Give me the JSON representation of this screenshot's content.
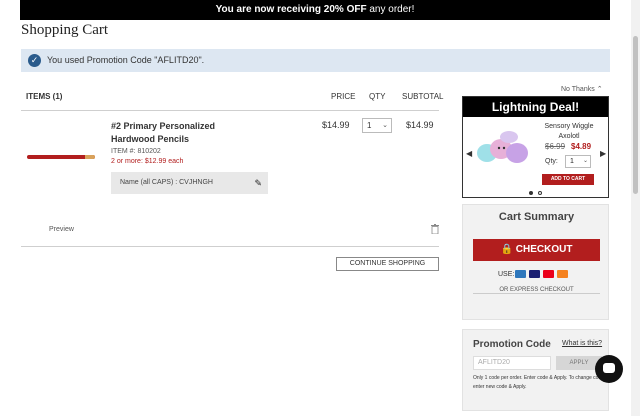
{
  "banner": {
    "bold": "You are now receiving 20% OFF",
    "rest": " any order!"
  },
  "page_title": "Shopping Cart",
  "promo_alert": "You used Promotion Code \"AFLITD20\".",
  "cart": {
    "items_header": "ITEMS (1)",
    "col_price": "PRICE",
    "col_qty": "QTY",
    "col_subtotal": "SUBTOTAL",
    "item": {
      "name": "#2 Primary Personalized Hardwood Pencils",
      "item_number": "ITEM #: 810202",
      "bulk_price": "2 or more: $12.99 each",
      "personalization": "Name (all CAPS) : CVJHNGH",
      "price": "$14.99",
      "qty": "1",
      "subtotal": "$14.99"
    },
    "preview": "Preview",
    "continue_button": "CONTINUE SHOPPING"
  },
  "deal": {
    "no_thanks": "No Thanks",
    "title": "Lightning Deal!",
    "product_name": "Sensory Wiggle Axolotl",
    "old_price": "$6.99",
    "new_price": "$4.89",
    "qty_label": "Qty:",
    "qty": "1",
    "add_button": "ADD TO CART"
  },
  "summary": {
    "title": "Cart Summary",
    "checkout_button": "CHECKOUT",
    "use_label": "USE:",
    "express": "OR EXPRESS CHECKOUT"
  },
  "promo": {
    "title": "Promotion Code",
    "what_is": "What is this?",
    "placeholder": "AFLITD20",
    "apply_button": "APPLY",
    "note": "Only 1 code per order. Enter code & Apply. To change code, enter new code & Apply."
  },
  "colors": {
    "brand_red": "#b21e1e",
    "alert_bg": "#dde7f2",
    "check_blue": "#2a5b8c"
  }
}
